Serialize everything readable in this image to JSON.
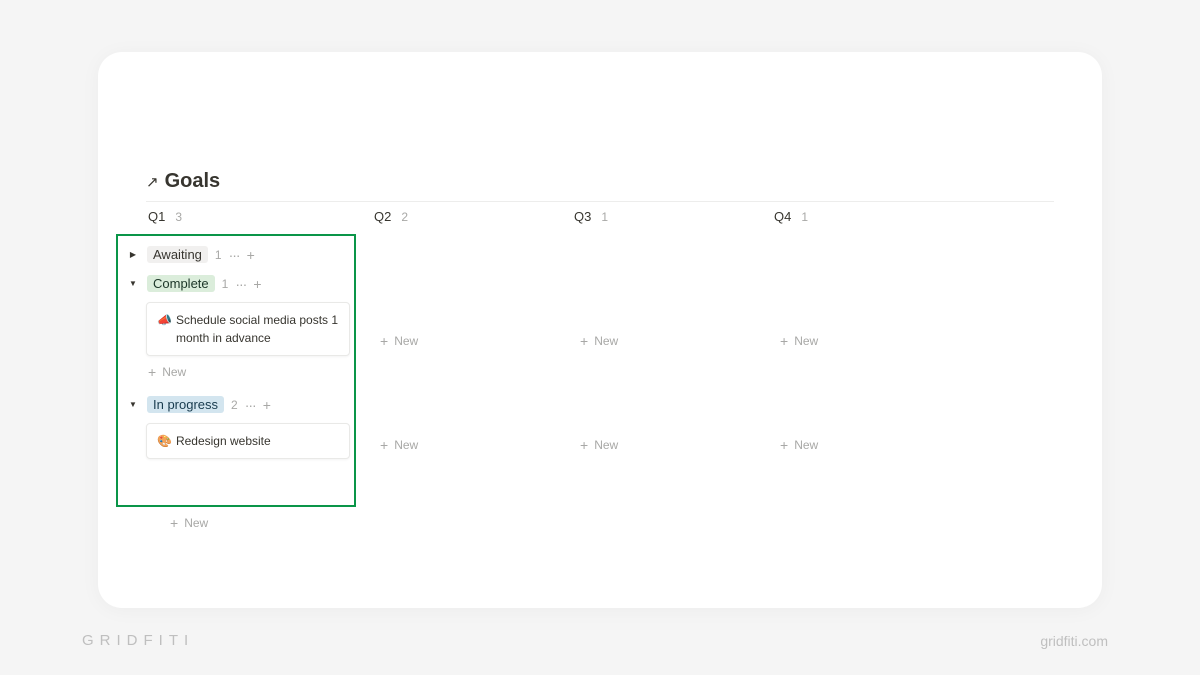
{
  "page": {
    "title": "Goals",
    "arrow": "↗"
  },
  "columns": [
    {
      "label": "Q1",
      "count": "3"
    },
    {
      "label": "Q2",
      "count": "2"
    },
    {
      "label": "Q3",
      "count": "1"
    },
    {
      "label": "Q4",
      "count": "1"
    }
  ],
  "groups": {
    "awaiting": {
      "label": "Awaiting",
      "count": "1"
    },
    "complete": {
      "label": "Complete",
      "count": "1"
    },
    "in_progress": {
      "label": "In progress",
      "count": "2"
    }
  },
  "cards": {
    "schedule": {
      "emoji": "📣",
      "text": "Schedule social media posts 1 month in advance"
    },
    "redesign": {
      "emoji": "🎨",
      "text": "Redesign website"
    }
  },
  "labels": {
    "new": "New",
    "plus": "+",
    "dots": "···"
  },
  "watermark": {
    "left": "GRIDFITI",
    "right": "gridfiti.com"
  }
}
